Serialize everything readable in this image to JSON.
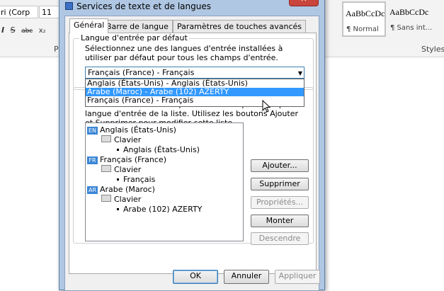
{
  "word": {
    "font_name": "ri (Corp",
    "font_size": "11",
    "format_buttons": [
      "I",
      "S",
      "abc",
      "x₂"
    ],
    "group_label": "Po",
    "styles": [
      {
        "preview": "AaBbCcDc",
        "name": "¶ Normal"
      },
      {
        "preview": "AaBbCcDc",
        "name": "¶ Sans int..."
      }
    ],
    "styles_label": "Styles"
  },
  "dialog": {
    "title": "Services de texte et de langues",
    "close_glyph": "✕",
    "tabs": [
      {
        "label": "Général",
        "active": true
      },
      {
        "label": "Barre de langue",
        "active": false
      },
      {
        "label": "Paramètres de touches avancés",
        "active": false
      }
    ],
    "default_input": {
      "legend": "Langue d'entrée par défaut",
      "description": "Sélectionnez une des langues d'entrée installées à utiliser par défaut pour tous les champs d'entrée.",
      "selected": "Français (France) - Français",
      "options": [
        "Anglais (États-Unis) - Anglais (États-Unis)",
        "Arabe (Maroc) - Arabe (102) AZERTY",
        "Français (France) - Français"
      ],
      "highlighted_index": 1
    },
    "services": {
      "description": "Choisissez les services que vous voulez pour chaque langue d'entrée de la liste. Utilisez les boutons Ajouter et Supprimer pour modifier cette liste.",
      "tree": [
        {
          "badge": "EN",
          "language": "Anglais (États-Unis)",
          "category": "Clavier",
          "item": "Anglais (États-Unis)"
        },
        {
          "badge": "FR",
          "language": "Français (France)",
          "category": "Clavier",
          "item": "Français"
        },
        {
          "badge": "AR",
          "language": "Arabe (Maroc)",
          "category": "Clavier",
          "item": "Arabe (102) AZERTY"
        }
      ],
      "buttons": {
        "add": "Ajouter...",
        "remove": "Supprimer",
        "properties": "Propriétés...",
        "move_up": "Monter",
        "move_down": "Descendre"
      }
    },
    "footer": {
      "ok": "OK",
      "cancel": "Annuler",
      "apply": "Appliquer"
    }
  }
}
